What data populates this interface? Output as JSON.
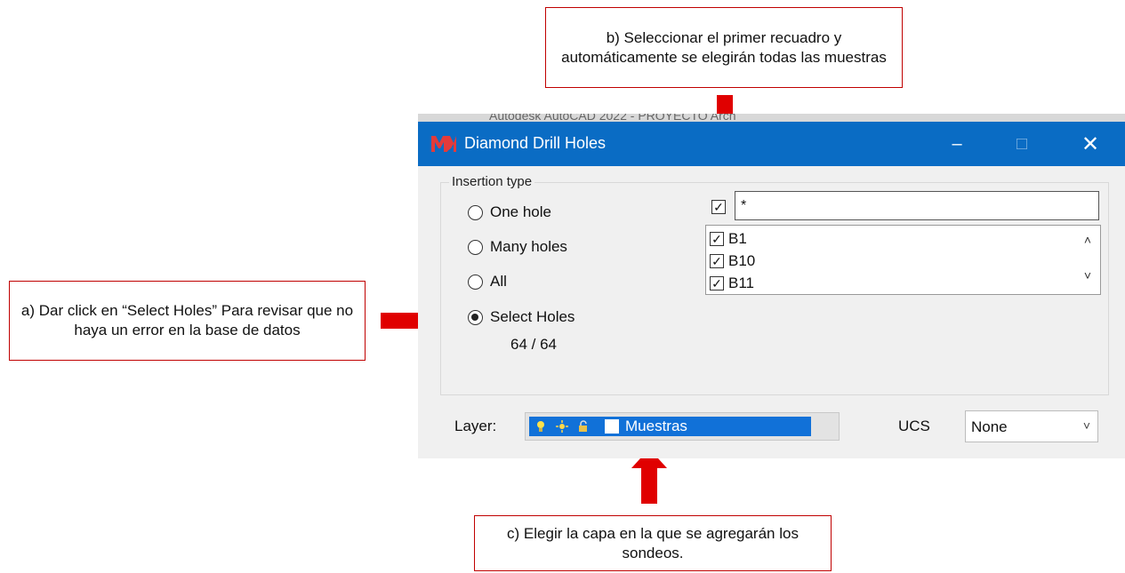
{
  "callouts": {
    "a": "a) Dar click en “Select Holes” Para revisar que no haya un error en la base de datos",
    "b": "b) Seleccionar el primer recuadro y automáticamente se elegirán todas las muestras",
    "c": "c) Elegir la capa en la que se agregarán los sondeos."
  },
  "background_window": {
    "title_fragment": "Autodesk AutoCAD 2022 - PROYECTO Arch"
  },
  "dialog": {
    "title": "Diamond Drill Holes",
    "controls": {
      "minimize": "–",
      "maximize": "□",
      "close": "✕"
    },
    "insertion_type": {
      "label": "Insertion type",
      "options": [
        {
          "label": "One hole",
          "selected": false
        },
        {
          "label": "Many holes",
          "selected": false
        },
        {
          "label": "All",
          "selected": false
        },
        {
          "label": "Select Holes",
          "selected": true
        }
      ],
      "count": "64 / 64"
    },
    "filter": {
      "checked": true,
      "value": "*"
    },
    "holes": [
      {
        "label": "B1",
        "checked": true
      },
      {
        "label": "B10",
        "checked": true
      },
      {
        "label": "B11",
        "checked": true
      }
    ],
    "layer": {
      "label": "Layer:",
      "value": "Muestras"
    },
    "ucs": {
      "label": "UCS",
      "value": "None"
    }
  },
  "colors": {
    "accent": "#0a6cc4",
    "arrow": "#e00000",
    "callout_border": "#c00000",
    "selection": "#1171d8"
  },
  "icons": [
    "minus-icon",
    "square-icon",
    "close-icon",
    "check-icon",
    "chevron-up-icon",
    "chevron-down-icon",
    "bulb-icon",
    "sun-icon",
    "lock-icon"
  ]
}
